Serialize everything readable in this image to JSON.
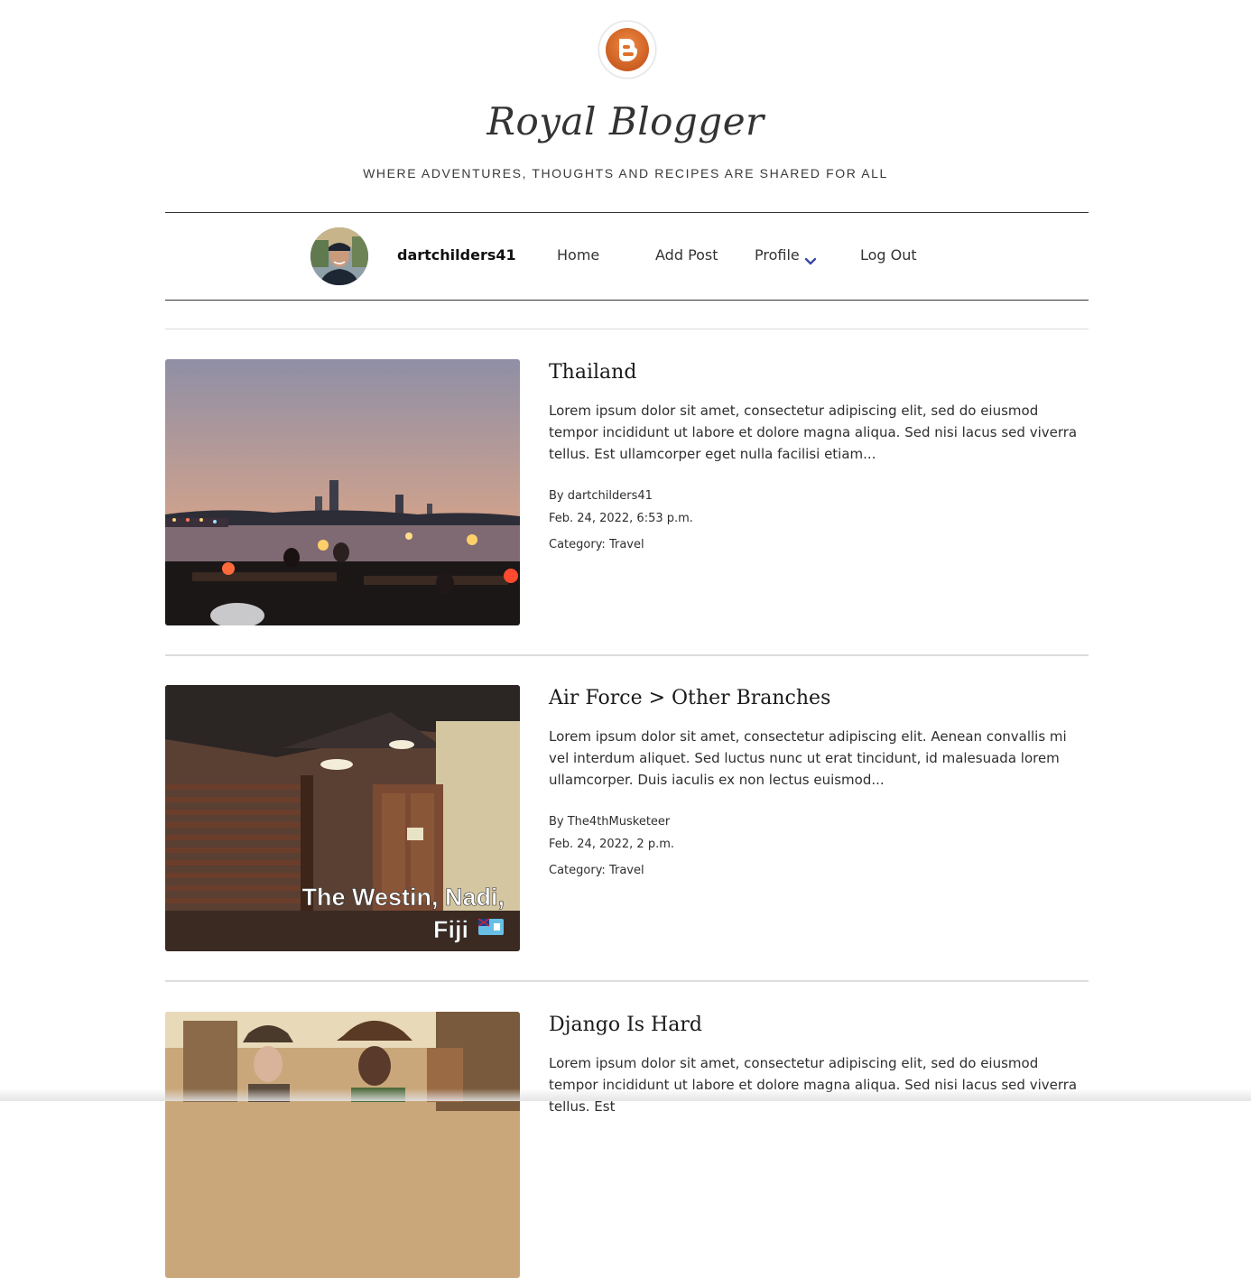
{
  "site": {
    "title": "Royal Blogger",
    "tagline": "WHERE ADVENTURES, THOUGHTS AND RECIPES ARE SHARED FOR ALL",
    "logo_icon": "blogger-logo-icon",
    "accent_color": "#e0702a"
  },
  "nav": {
    "username": "dartchilders41",
    "home_label": "Home",
    "add_post_label": "Add Post",
    "profile_label": "Profile",
    "logout_label": "Log Out",
    "chevron_color": "#3b4aa8"
  },
  "posts": [
    {
      "title": "Thailand",
      "excerpt": "Lorem ipsum dolor sit amet, consectetur adipiscing elit, sed do eiusmod tempor incididunt ut labore et dolore magna aliqua. Sed nisi lacus sed viverra tellus. Est ullamcorper eget nulla facilisi etiam...",
      "author": "By dartchilders41",
      "date": "Feb. 24, 2022, 6:53 p.m.",
      "category": "Category: Travel"
    },
    {
      "title": "Air Force > Other Branches",
      "excerpt": "Lorem ipsum dolor sit amet, consectetur adipiscing elit. Aenean convallis mi vel interdum aliquet. Sed luctus nunc ut erat tincidunt, id malesuada lorem ullamcorper. Duis iaculis ex non lectus euismod...",
      "author": "By The4thMusketeer",
      "date": "Feb. 24, 2022, 2 p.m.",
      "category": "Category: Travel",
      "image_caption_line1": "The Westin, Nadi,",
      "image_caption_line2": "Fiji"
    },
    {
      "title": "Django Is Hard",
      "excerpt": "Lorem ipsum dolor sit amet, consectetur adipiscing elit, sed do eiusmod tempor incididunt ut labore et dolore magna aliqua. Sed nisi lacus sed viverra tellus. Est"
    }
  ]
}
